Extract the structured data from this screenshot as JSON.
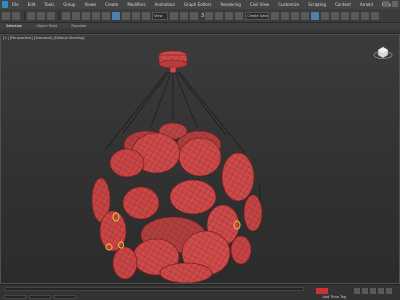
{
  "menu": {
    "items": [
      "File",
      "Edit",
      "Tools",
      "Group",
      "Views",
      "Create",
      "Modifiers",
      "Animation",
      "Graph Editors",
      "Rendering",
      "Civil View",
      "Customize",
      "Scripting",
      "Content",
      "Arnold",
      "Help"
    ]
  },
  "toolbar": {
    "view_dropdown": "View",
    "selection_set": "Create Selection Se",
    "snap_num": "3",
    "angle_snap": "2.5"
  },
  "ribbon": {
    "tabs": [
      "Selection",
      "Object Paint",
      "Populate"
    ]
  },
  "viewport": {
    "label": "[+] [Perspective] [Standard] [Default Shading]"
  },
  "statusbar": {
    "add_time_tag": "Add Time Tag"
  },
  "colors": {
    "model_fill": "#cc4a4a",
    "model_wire": "#7a1f1f",
    "model_highlight": "#e06a6a",
    "cable": "#1a1a1a",
    "accent_yellow": "#d9b43a"
  }
}
